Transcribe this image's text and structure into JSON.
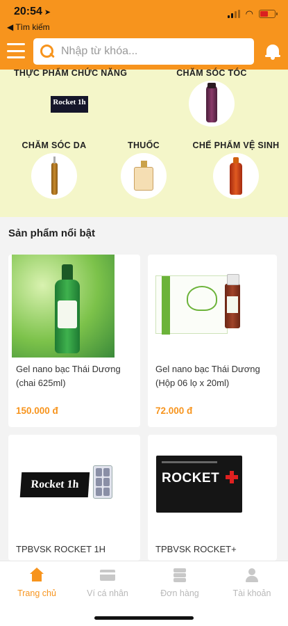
{
  "status_bar": {
    "time": "20:54",
    "back_label": "◀ Tìm kiếm"
  },
  "header": {
    "search_placeholder": "Nhập từ khóa..."
  },
  "categories": [
    {
      "label": "THỰC PHẨM CHỨC NĂNG"
    },
    {
      "label": "CHĂM SÓC TÓC"
    },
    {
      "label": "CHĂM SÓC DA"
    },
    {
      "label": "THUỐC"
    },
    {
      "label": "CHẾ PHẨM VỆ SINH"
    }
  ],
  "featured": {
    "title": "Sản phẩm nổi bật",
    "products": [
      {
        "name": "Gel nano bạc Thái Dương (chai 625ml)",
        "price": "150.000 đ"
      },
      {
        "name": "Gel nano bạc Thái Dương (Hộp 06 lọ x 20ml)",
        "price": "72.000 đ"
      },
      {
        "name": "TPBVSK ROCKET 1H",
        "price": ""
      },
      {
        "name": "TPBVSK ROCKET+",
        "price": ""
      }
    ],
    "package_text": {
      "rocket_1h": "Rocket 1h",
      "rocket_plus": "ROCKET"
    }
  },
  "bottom_nav": [
    {
      "label": "Trang chủ",
      "icon": "home-icon",
      "active": true
    },
    {
      "label": "Ví cá nhân",
      "icon": "wallet-icon",
      "active": false
    },
    {
      "label": "Đơn hàng",
      "icon": "layers-icon",
      "active": false
    },
    {
      "label": "Tài khoản",
      "icon": "user-icon",
      "active": false
    }
  ],
  "colors": {
    "accent": "#f7941d",
    "category_bg": "#f4f6c9",
    "price": "#f7941d",
    "inactive_nav": "#b8b8b8"
  }
}
